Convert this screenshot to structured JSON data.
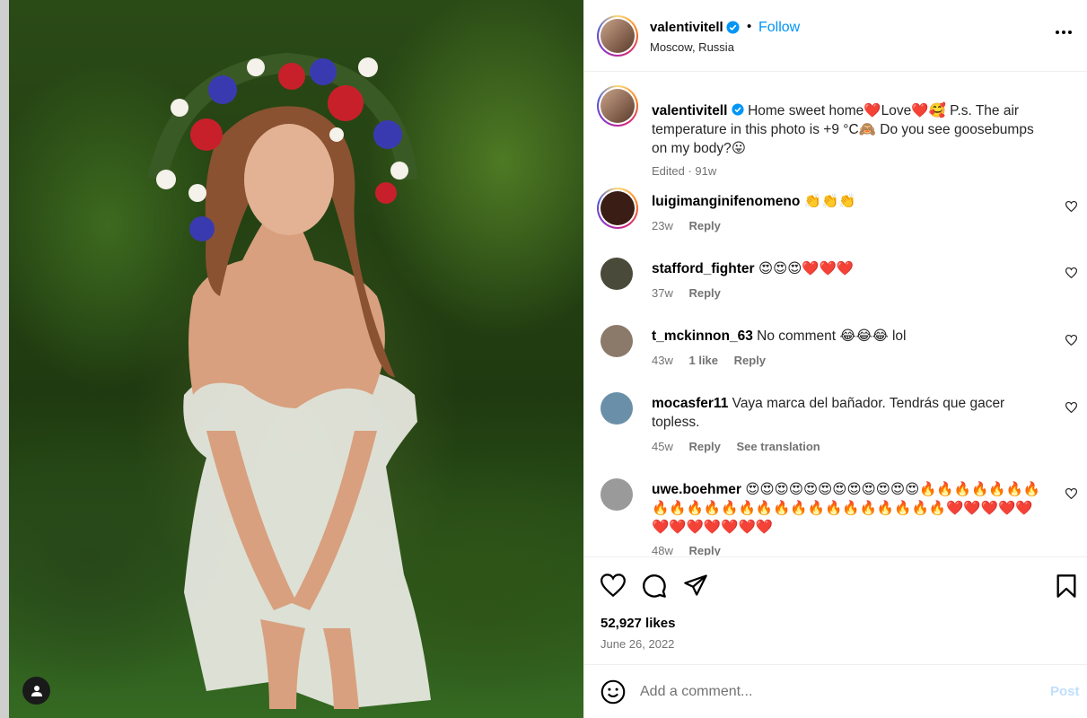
{
  "post": {
    "username": "valentivitell",
    "follow_label": "Follow",
    "location": "Moscow, Russia",
    "separator": "•"
  },
  "caption": {
    "username": "valentivitell",
    "text": "Home sweet home❤️Love❤️🥰 P.s. The air temperature in this photo is +9 °C🙈 Do you see goosebumps on my body?😛",
    "edited_label": "Edited · 91w"
  },
  "comments": [
    {
      "username": "luigimanginifenomeno",
      "text": "👏👏👏",
      "age": "23w",
      "likes": "",
      "reply_label": "Reply",
      "translate_label": "",
      "avatar_color": "#3a1d14"
    },
    {
      "username": "stafford_fighter",
      "text": "😍😍😍❤️❤️❤️",
      "age": "37w",
      "likes": "",
      "reply_label": "Reply",
      "translate_label": "",
      "avatar_color": "#4a4a3a"
    },
    {
      "username": "t_mckinnon_63",
      "text": "No comment 😂😂😂 lol",
      "age": "43w",
      "likes": "1 like",
      "reply_label": "Reply",
      "translate_label": "",
      "avatar_color": "#8b7a6a"
    },
    {
      "username": "mocasfer11",
      "text": "Vaya marca del bañador. Tendrás que gacer topless.",
      "age": "45w",
      "likes": "",
      "reply_label": "Reply",
      "translate_label": "See translation",
      "avatar_color": "#6a8fa8"
    },
    {
      "username": "uwe.boehmer",
      "text": "😍😍😍😍😍😍😍😍😍😍😍😍🔥🔥🔥🔥🔥🔥🔥🔥🔥🔥🔥🔥🔥🔥🔥🔥🔥🔥🔥🔥🔥🔥🔥🔥❤️❤️❤️❤️❤️❤️❤️❤️❤️❤️❤️❤️",
      "age": "48w",
      "likes": "",
      "reply_label": "Reply",
      "translate_label": "",
      "avatar_color": "#9a9a9a"
    }
  ],
  "stats": {
    "likes": "52,927 likes",
    "date": "June 26, 2022"
  },
  "composer": {
    "placeholder": "Add a comment...",
    "post_label": "Post"
  },
  "icons": [
    "verified-badge-icon",
    "more-options-icon",
    "like-heart-icon",
    "comment-icon",
    "share-icon",
    "save-bookmark-icon",
    "emoji-icon",
    "user-tag-icon",
    "comment-like-icon"
  ],
  "colors": {
    "link": "#0095f6",
    "muted": "#737373",
    "post_disabled": "#c0dffd"
  }
}
